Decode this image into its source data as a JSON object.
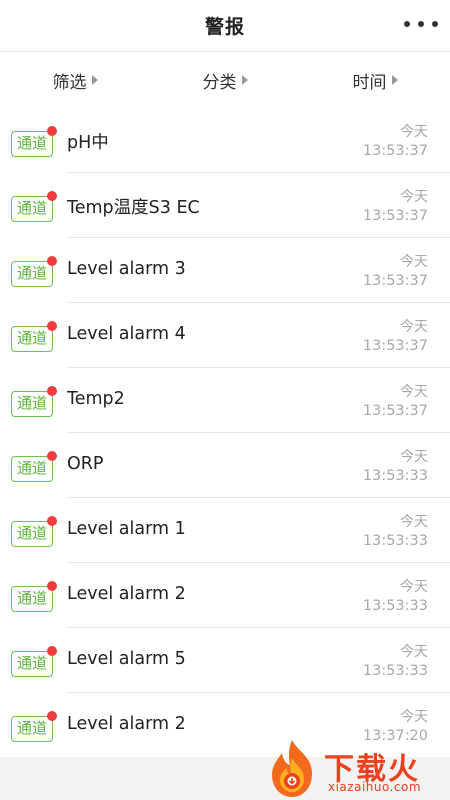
{
  "header": {
    "title": "警报"
  },
  "filters": [
    {
      "label": "筛选"
    },
    {
      "label": "分类"
    },
    {
      "label": "时间"
    }
  ],
  "alarms": [
    {
      "badge": "通道",
      "name": "pH中",
      "day": "今天",
      "time": "13:53:37"
    },
    {
      "badge": "通道",
      "name": "Temp温度S3 EC",
      "day": "今天",
      "time": "13:53:37"
    },
    {
      "badge": "通道",
      "name": "Level alarm 3",
      "day": "今天",
      "time": "13:53:37"
    },
    {
      "badge": "通道",
      "name": "Level alarm 4",
      "day": "今天",
      "time": "13:53:37"
    },
    {
      "badge": "通道",
      "name": "Temp2",
      "day": "今天",
      "time": "13:53:37"
    },
    {
      "badge": "通道",
      "name": "ORP",
      "day": "今天",
      "time": "13:53:33"
    },
    {
      "badge": "通道",
      "name": "Level alarm 1",
      "day": "今天",
      "time": "13:53:33"
    },
    {
      "badge": "通道",
      "name": "Level alarm 2",
      "day": "今天",
      "time": "13:53:33"
    },
    {
      "badge": "通道",
      "name": "Level alarm 5",
      "day": "今天",
      "time": "13:53:33"
    },
    {
      "badge": "通道",
      "name": "Level alarm 2",
      "day": "今天",
      "time": "13:37:20"
    }
  ],
  "watermark": {
    "text": "下载火",
    "url": "xiazaihuo.com"
  },
  "colors": {
    "badge_green": "#5cb83a",
    "unread_dot": "#f03c3c",
    "watermark": "#e8421e"
  }
}
